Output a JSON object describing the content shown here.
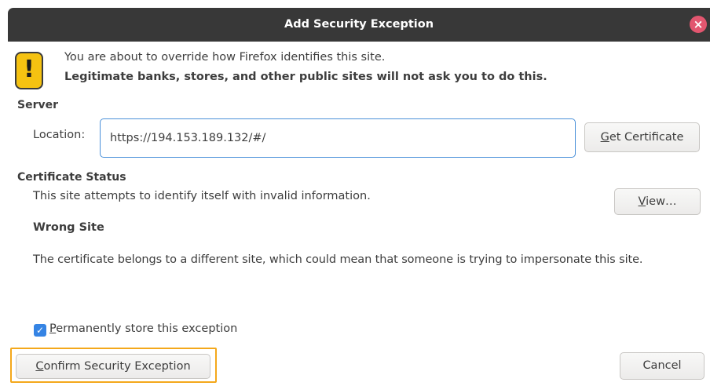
{
  "dialog": {
    "title": "Add Security Exception",
    "close_glyph": "×"
  },
  "intro": {
    "line1": "You are about to override how Firefox identifies this site.",
    "line2": "Legitimate banks, stores, and other public sites will not ask you to do this.",
    "warning_glyph": "!"
  },
  "server": {
    "heading": "Server",
    "location_label": "Location:",
    "location_value": "https://194.153.189.132/#/",
    "get_certificate_mnemonic": "G",
    "get_certificate_rest": "et Certificate"
  },
  "status": {
    "heading": "Certificate Status",
    "description": "This site attempts to identify itself with invalid information.",
    "view_mnemonic": "V",
    "view_rest": "iew…",
    "problem_title": "Wrong Site",
    "problem_description": "The certificate belongs to a different site, which could mean that someone is trying to impersonate this site."
  },
  "store": {
    "checked": true,
    "check_glyph": "✓",
    "label_mnemonic": "P",
    "label_rest": "ermanently store this exception"
  },
  "actions": {
    "confirm_mnemonic": "C",
    "confirm_rest": "onfirm Security Exception",
    "cancel_label": "Cancel"
  },
  "colors": {
    "titlebar": "#383838",
    "close": "#e2566f",
    "warning": "#f5c211",
    "focus_ring": "#f4a81b",
    "accent": "#3584e4"
  }
}
